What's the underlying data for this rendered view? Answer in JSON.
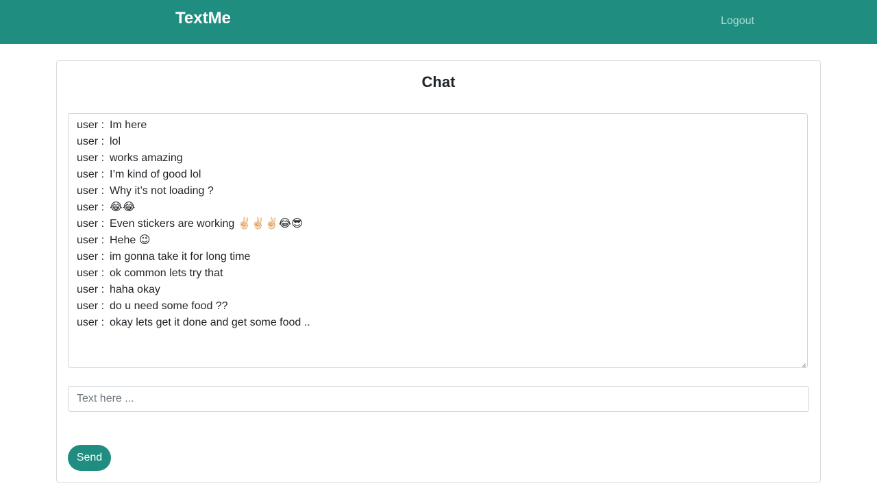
{
  "navbar": {
    "brand": "TextMe",
    "logout_label": "Logout",
    "color": "#1f8d7f"
  },
  "chat": {
    "title": "Chat",
    "messages": [
      {
        "user": "user :",
        "text": "Im here"
      },
      {
        "user": "user :",
        "text": "lol"
      },
      {
        "user": "user :",
        "text": "works amazing"
      },
      {
        "user": "user :",
        "text": "I’m kind of good lol"
      },
      {
        "user": "user :",
        "text": "Why it’s not loading ?"
      },
      {
        "user": "user :",
        "text": "😂😂"
      },
      {
        "user": "user :",
        "text": "Even stickers are working ✌🏻✌🏻✌🏻😂😎"
      },
      {
        "user": "user :",
        "text": "Hehe 😉"
      },
      {
        "user": "user :",
        "text": "im gonna take it for long time"
      },
      {
        "user": "user :",
        "text": "ok common lets try that"
      },
      {
        "user": "user :",
        "text": "haha okay"
      },
      {
        "user": "user :",
        "text": "do u need some food ??"
      },
      {
        "user": "user :",
        "text": "okay lets get it done and get some food .."
      }
    ],
    "input_value": "",
    "input_placeholder": "Text here ...",
    "send_label": "Send"
  }
}
